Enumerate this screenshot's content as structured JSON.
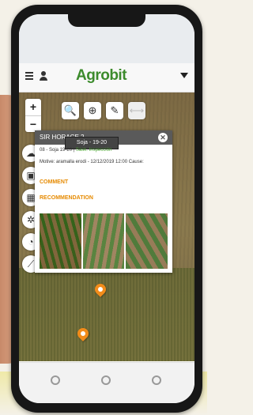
{
  "app": {
    "logo_text": "Agrobit"
  },
  "header": {
    "menu_icon": "menu-icon",
    "user_icon": "user-icon",
    "dropdown_icon": "chevron-down-icon"
  },
  "map": {
    "zoom_in": "+",
    "zoom_out": "−",
    "toolbar": [
      {
        "icon": "search-icon",
        "glyph": "🔍"
      },
      {
        "icon": "add-icon",
        "glyph": "⊕"
      },
      {
        "icon": "pencil-icon",
        "glyph": "✎"
      },
      {
        "icon": "ruler-icon",
        "glyph": "⟷"
      }
    ],
    "side_buttons": [
      "weather-icon",
      "camera-icon",
      "calendar-icon",
      "bug-icon",
      "pie-chart-icon",
      "trend-icon"
    ]
  },
  "popup": {
    "title": "SIR HORACE 2",
    "tooltip": "Soja - 19-20",
    "line1_prefix": "08 - Soja 19-20 | ",
    "line1_status": "Sask. Inspección",
    "line2": "Motive: aramalla erodi - 12/12/2019 12:00 Cause:",
    "comment_label": "COMMENT",
    "recommendation_label": "RECOMMENDATION"
  },
  "colors": {
    "brand_green": "#3c8b2c",
    "accent_orange": "#e68a00",
    "pin_orange": "#f28c1a"
  }
}
